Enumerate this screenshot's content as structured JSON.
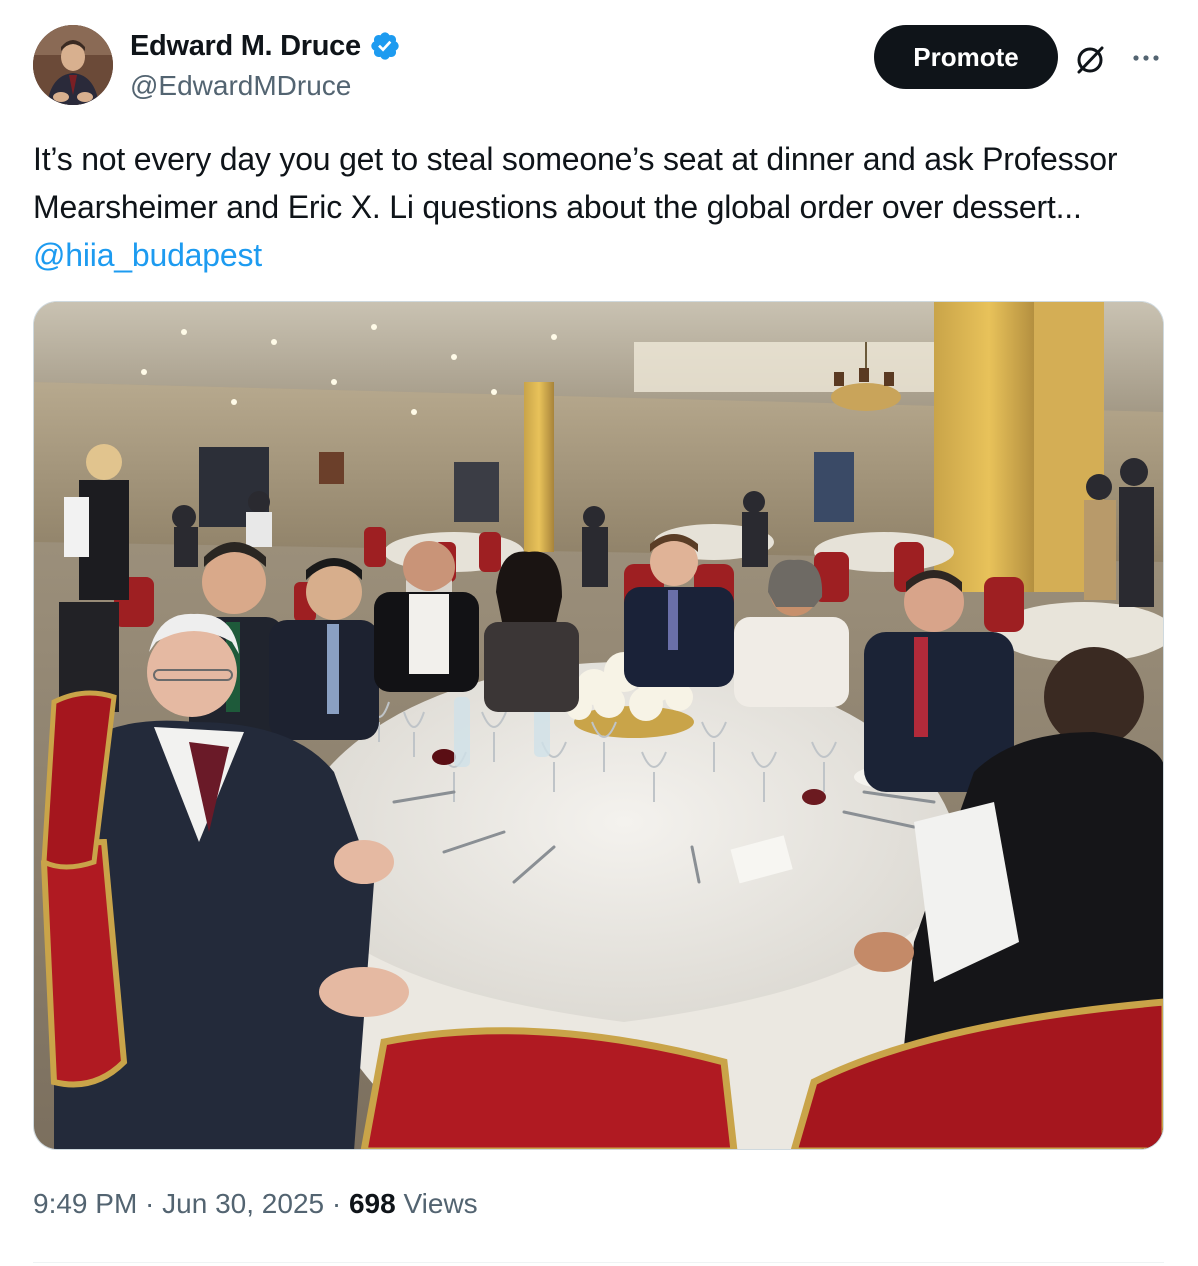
{
  "author": {
    "display_name": "Edward M. Druce",
    "handle": "@EdwardMDruce",
    "verified_icon": "verified-badge-icon",
    "verified_color": "#1d9bf0"
  },
  "actions": {
    "promote_label": "Promote",
    "grok_icon": "grok-icon",
    "more_icon": "more-icon"
  },
  "tweet": {
    "text": "It’s not every day you get to steal someone’s seat at dinner and ask Professor Mearsheimer and Eric X. Li questions about the global order over dessert... ",
    "mention": "@hiia_budapest",
    "mention_color": "#1d9bf0"
  },
  "media": {
    "icon": "photo-dinner-table"
  },
  "meta": {
    "time": "9:49 PM",
    "sep1": " · ",
    "date": "Jun 30, 2025",
    "sep2": " · ",
    "views_count": "698",
    "views_label": " Views"
  }
}
